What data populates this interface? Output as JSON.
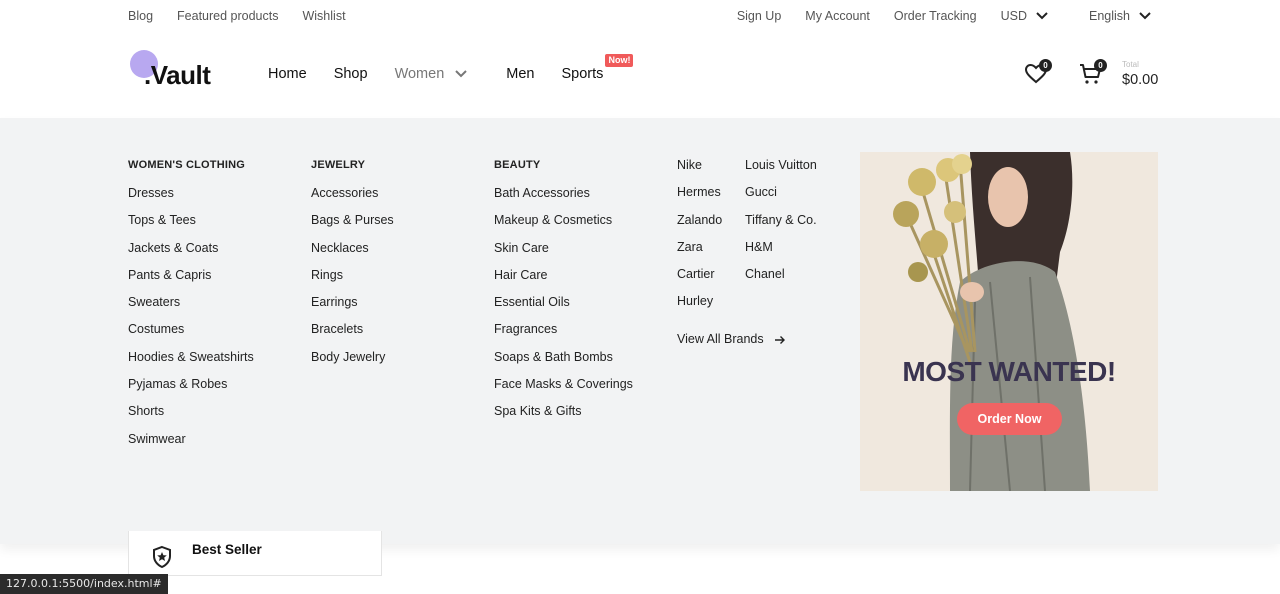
{
  "topbar": {
    "left_links": [
      "Blog",
      "Featured products",
      "Wishlist"
    ],
    "sign_up": "Sign Up",
    "my_account": "My Account",
    "order_tracking": "Order Tracking",
    "currency": "USD",
    "language": "English"
  },
  "logo": {
    "text": ".Vault",
    "dot_color": "#b8a8f0"
  },
  "nav": {
    "home": "Home",
    "shop": "Shop",
    "women": "Women",
    "men": "Men",
    "sports": "Sports",
    "sports_badge": "Now!"
  },
  "header_icons": {
    "wishlist_icon": "heart-icon",
    "wishlist_count": "0",
    "cart_icon": "cart-icon",
    "cart_count": "0",
    "total_label": "Total",
    "total_value": "$0.00"
  },
  "mega": {
    "clothing": {
      "title": "WOMEN'S CLOTHING",
      "items": [
        "Dresses",
        "Tops & Tees",
        "Jackets & Coats",
        "Pants & Capris",
        "Sweaters",
        "Costumes",
        "Hoodies & Sweatshirts",
        "Pyjamas & Robes",
        "Shorts",
        "Swimwear"
      ]
    },
    "jewelry": {
      "title": "JEWELRY",
      "items": [
        "Accessories",
        "Bags & Purses",
        "Necklaces",
        "Rings",
        "Earrings",
        "Bracelets",
        "Body Jewelry"
      ]
    },
    "beauty": {
      "title": "BEAUTY",
      "items": [
        "Bath Accessories",
        "Makeup & Cosmetics",
        "Skin Care",
        "Hair Care",
        "Essential Oils",
        "Fragrances",
        "Soaps & Bath Bombs",
        "Face Masks & Coverings",
        "Spa Kits & Gifts"
      ]
    },
    "brands_a": [
      "Nike",
      "Hermes",
      "Zalando",
      "Zara",
      "Cartier",
      "Hurley"
    ],
    "brands_b": [
      "Louis Vuitton",
      "Gucci",
      "Tiffany & Co.",
      "H&M",
      "Chanel"
    ],
    "view_all": "View All Brands",
    "promo": {
      "title": "MOST WANTED!",
      "button": "Order Now",
      "button_color": "#f06464"
    }
  },
  "below": {
    "best_seller": "Best Seller"
  },
  "status_url": "127.0.0.1:5500/index.html#"
}
